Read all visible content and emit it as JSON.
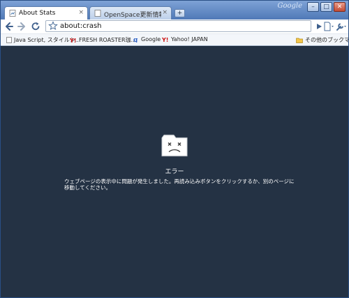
{
  "window": {
    "title_brand": "Google",
    "controls": {
      "minimize": "–",
      "maximize": "□",
      "close": "✕"
    }
  },
  "tabs": [
    {
      "label": "About Stats",
      "close": "×",
      "active": true
    },
    {
      "label": "OpenSpace更新情報",
      "close": "×",
      "active": false
    }
  ],
  "new_tab_label": "+",
  "toolbar": {
    "url": "about:crash",
    "icons": [
      "back-icon",
      "forward-icon",
      "reload-icon",
      "star-icon",
      "go-icon",
      "page-menu-icon",
      "wrench-icon"
    ]
  },
  "bookmarks": {
    "items": [
      {
        "label": "Java Script, スタイルシ..",
        "icon": "page-icon"
      },
      {
        "label": "FRESH ROASTER珈...",
        "icon": "yahoo-icon"
      },
      {
        "label": "Google",
        "icon": "google-icon"
      },
      {
        "label": "Yahoo! JAPAN",
        "icon": "yahoo-icon"
      }
    ],
    "other": {
      "label": "その他のブックマーク",
      "icon": "folder-icon"
    }
  },
  "error": {
    "title": "エラー",
    "message": "ウェブページの表示中に問題が発生しました。再読み込みボタンをクリックするか、別のページに移動してください。"
  },
  "colors": {
    "content_bg": "#243244",
    "titlebar": "#5b83bd",
    "accent": "#cc1111"
  }
}
